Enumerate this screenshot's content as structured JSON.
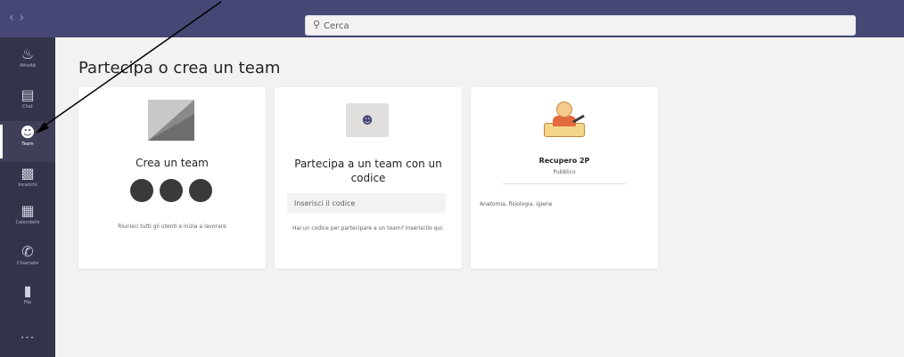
{
  "header": {
    "back_icon": "chevron-left-icon",
    "forward_icon": "chevron-right-icon",
    "search": {
      "placeholder": "Cerca",
      "icon": "search-icon"
    }
  },
  "rail": {
    "items": [
      {
        "label": "Attività",
        "icon": "bell-icon"
      },
      {
        "label": "Chat",
        "icon": "chat-icon"
      },
      {
        "label": "Team",
        "icon": "teams-icon",
        "active": true
      },
      {
        "label": "Incarichi",
        "icon": "backpack-icon"
      },
      {
        "label": "Calendario",
        "icon": "calendar-icon"
      },
      {
        "label": "Chiamate",
        "icon": "phone-icon"
      },
      {
        "label": "File",
        "icon": "file-icon"
      }
    ],
    "more_label": "..."
  },
  "main": {
    "title": "Partecipa o crea un team",
    "create_card": {
      "title": "Crea un team",
      "description": "Riunisci tutti gli utenti e inizia a lavorare"
    },
    "join_card": {
      "title": "Partecipa a un team con un codice",
      "input_placeholder": "Inserisci il codice",
      "description": "Hai un codice per partecipare a un team? Inseriscilo qui."
    },
    "team_card": {
      "name": "Recupero 2P",
      "visibility": "Pubblico",
      "description": "Anatomia, fisiologia, igiene"
    }
  },
  "colors": {
    "top_bar": "#464775",
    "left_rail": "#33344a",
    "background": "#f3f2f1",
    "card": "#ffffff",
    "annotation": "#000000"
  }
}
